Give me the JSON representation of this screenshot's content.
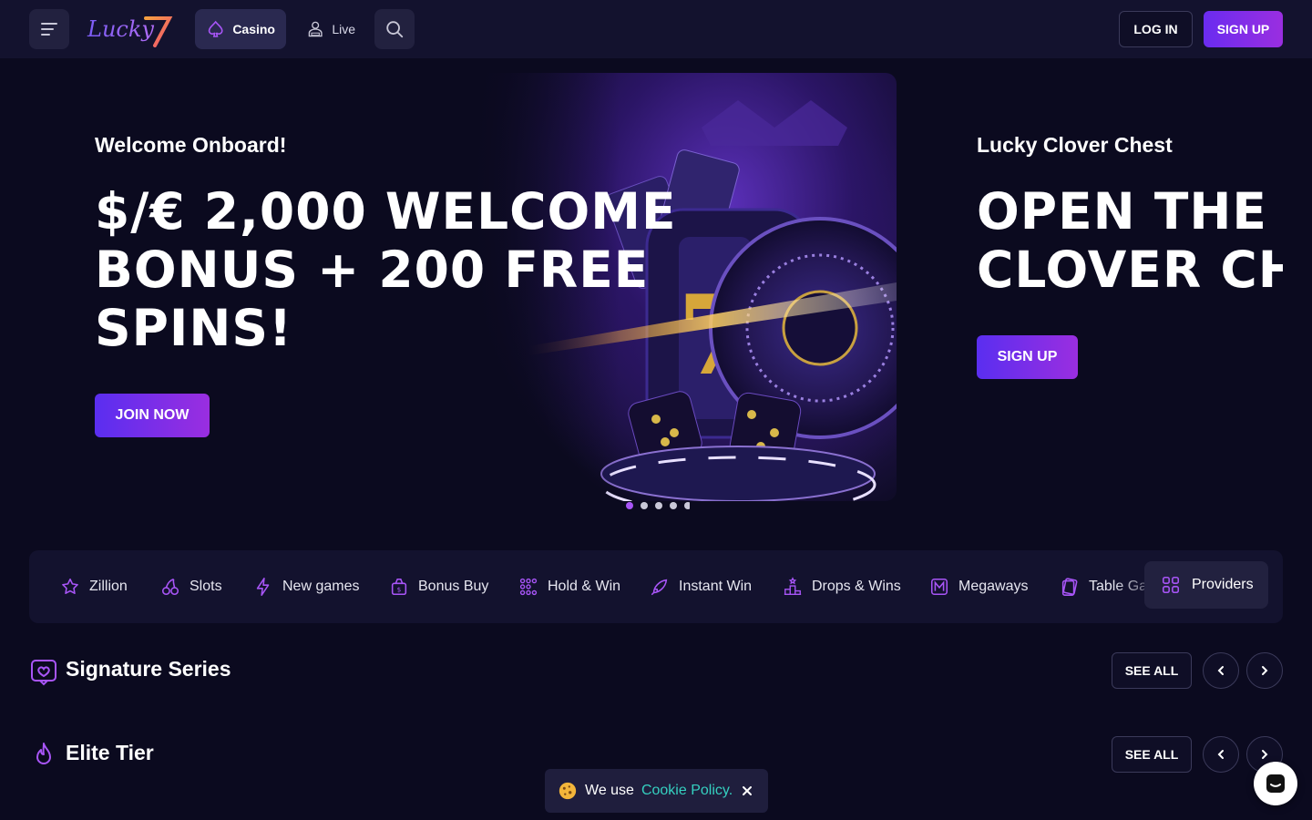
{
  "header": {
    "logo_text": "Lucky7",
    "tabs": [
      {
        "label": "Casino",
        "icon": "spade-icon",
        "active": true
      },
      {
        "label": "Live",
        "icon": "dealer-icon",
        "active": false
      }
    ],
    "login_label": "LOG IN",
    "signup_label": "SIGN UP"
  },
  "hero": {
    "subtitle": "Welcome Onboard!",
    "title": "$/€ 2,000 WELCOME BONUS + 200 FREE SPINS!",
    "cta_label": "JOIN NOW",
    "slide_count": 5,
    "active_slide": 1
  },
  "hero_next": {
    "subtitle": "Lucky Clover Chest",
    "title": "OPEN THE LUCKY CLOVER CHEST",
    "cta_label": "SIGN UP"
  },
  "categories": {
    "items": [
      {
        "label": "Zillion",
        "icon": "star-icon"
      },
      {
        "label": "Slots",
        "icon": "cherries-icon"
      },
      {
        "label": "New games",
        "icon": "lightning-icon"
      },
      {
        "label": "Bonus Buy",
        "icon": "money-bag-icon"
      },
      {
        "label": "Hold & Win",
        "icon": "grid-dots-icon"
      },
      {
        "label": "Instant Win",
        "icon": "rocket-icon"
      },
      {
        "label": "Drops & Wins",
        "icon": "podium-icon"
      },
      {
        "label": "Megaways",
        "icon": "megaways-icon"
      },
      {
        "label": "Table Games",
        "icon": "cards-icon"
      }
    ],
    "providers_label": "Providers"
  },
  "sections": [
    {
      "title": "Signature Series",
      "icon": "heart-badge-icon",
      "see_all_label": "SEE ALL"
    },
    {
      "title": "Elite Tier",
      "icon": "flame-icon",
      "see_all_label": "SEE ALL"
    }
  ],
  "cookie": {
    "text": "We use",
    "link_text": "Cookie Policy."
  },
  "colors": {
    "background": "#0b0a1f",
    "panel": "#13122e",
    "accent_purple": "#a855f7",
    "cta_gradient_start": "#5a2ef0",
    "cta_gradient_end": "#9a2ee0",
    "link_teal": "#35d0c0"
  }
}
